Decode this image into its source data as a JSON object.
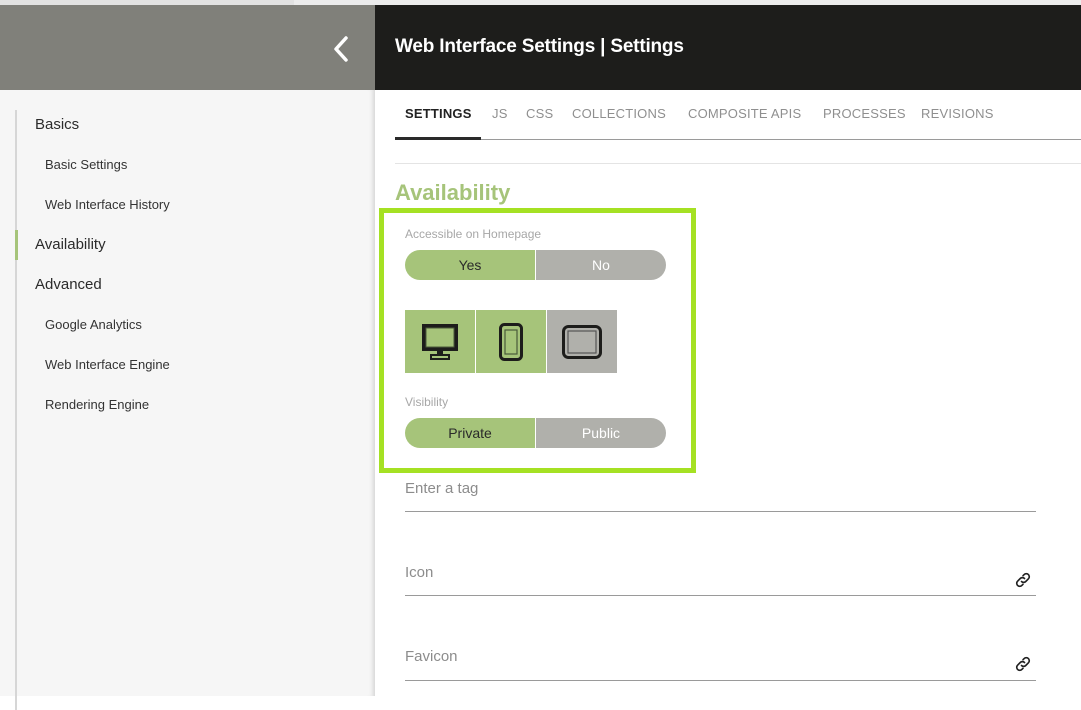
{
  "header": {
    "title": "Web Interface Settings | Settings",
    "back_icon": "chevron-left-icon"
  },
  "sidebar": {
    "items": [
      {
        "label": "Basics",
        "level": 1,
        "active": false
      },
      {
        "label": "Basic Settings",
        "level": 2,
        "active": false
      },
      {
        "label": "Web Interface History",
        "level": 2,
        "active": false
      },
      {
        "label": "Availability",
        "level": 1,
        "active": true
      },
      {
        "label": "Advanced",
        "level": 1,
        "active": false
      },
      {
        "label": "Google Analytics",
        "level": 2,
        "active": false
      },
      {
        "label": "Web Interface Engine",
        "level": 2,
        "active": false
      },
      {
        "label": "Rendering Engine",
        "level": 2,
        "active": false
      }
    ]
  },
  "tabs": [
    {
      "label": "SETTINGS",
      "active": true
    },
    {
      "label": "JS",
      "active": false
    },
    {
      "label": "CSS",
      "active": false
    },
    {
      "label": "COLLECTIONS",
      "active": false
    },
    {
      "label": "COMPOSITE APIS",
      "active": false
    },
    {
      "label": "PROCESSES",
      "active": false
    },
    {
      "label": "REVISIONS",
      "active": false
    }
  ],
  "availability": {
    "section_title": "Availability",
    "homepage": {
      "label": "Accessible on Homepage",
      "options": [
        "Yes",
        "No"
      ],
      "selected": "Yes"
    },
    "devices": [
      {
        "name": "desktop",
        "icon": "desktop-monitor-icon",
        "enabled": true
      },
      {
        "name": "phone",
        "icon": "mobile-phone-icon",
        "enabled": true
      },
      {
        "name": "tablet",
        "icon": "tablet-icon",
        "enabled": false
      }
    ],
    "visibility": {
      "label": "Visibility",
      "options": [
        "Private",
        "Public"
      ],
      "selected": "Private"
    }
  },
  "fields": {
    "tag": {
      "placeholder": "Enter a tag",
      "value": ""
    },
    "icon": {
      "placeholder": "Icon",
      "value": "",
      "action_icon": "link-icon"
    },
    "favicon": {
      "placeholder": "Favicon",
      "value": "",
      "action_icon": "link-icon"
    }
  },
  "colors": {
    "accent_green": "#a6c47a",
    "highlight_border": "#a5e123",
    "header_dark": "#1d1d1b",
    "header_gray": "#80807a",
    "toggle_off": "#b0b0ab"
  }
}
